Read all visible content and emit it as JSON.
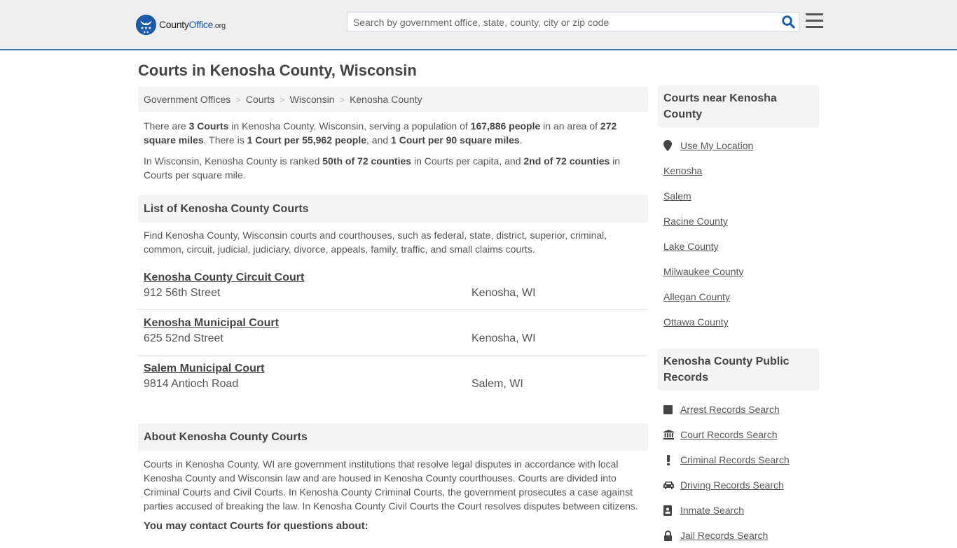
{
  "header": {
    "logo": {
      "part1": "County",
      "part2": "Office",
      "part3": ".org"
    },
    "search": {
      "placeholder": "Search by government office, state, county, city or zip code",
      "value": ""
    },
    "brand_color": "#1a5aa6",
    "accent_border": "#3b7cad"
  },
  "page": {
    "title": "Courts in Kenosha County, Wisconsin"
  },
  "breadcrumb": [
    {
      "label": "Government Offices"
    },
    {
      "label": "Courts"
    },
    {
      "label": "Wisconsin"
    },
    {
      "label": "Kenosha County"
    }
  ],
  "summary": {
    "p1": {
      "t1": "There are ",
      "b1": "3 Courts",
      "t2": " in Kenosha County, Wisconsin, serving a population of ",
      "b2": "167,886 people",
      "t3": " in an area of ",
      "b3": "272 square miles",
      "t4": ". There is ",
      "b4": "1 Court per 55,962 people",
      "t5": ", and ",
      "b5": "1 Court per 90 square miles",
      "t6": "."
    },
    "p2": {
      "t1": "In Wisconsin, Kenosha County is ranked ",
      "b1": "50th of 72 counties",
      "t2": " in Courts per capita, and ",
      "b2": "2nd of 72 counties",
      "t3": " in Courts per square mile."
    }
  },
  "list_section": {
    "heading": "List of Kenosha County Courts",
    "description": "Find Kenosha County, Wisconsin courts and courthouses, such as federal, state, district, superior, criminal, common, circuit, judicial, judiciary, divorce, appeals, family, traffic, and small claims courts.",
    "courts": [
      {
        "name": "Kenosha County Circuit Court",
        "address": "912 56th Street",
        "city": "Kenosha, WI"
      },
      {
        "name": "Kenosha Municipal Court",
        "address": "625 52nd Street",
        "city": "Kenosha, WI"
      },
      {
        "name": "Salem Municipal Court",
        "address": "9814 Antioch Road",
        "city": "Salem, WI"
      }
    ]
  },
  "about_section": {
    "heading": "About Kenosha County Courts",
    "body": "Courts in Kenosha County, WI are government institutions that resolve legal disputes in accordance with local Kenosha County and Wisconsin law and are housed in Kenosha County courthouses. Courts are divided into Criminal Courts and Civil Courts. In Kenosha County Criminal Courts, the government prosecutes a case against parties accused of breaking the law. In Kenosha County Civil Courts the Court resolves disputes between citizens.",
    "contact_heading": "You may contact Courts for questions about:"
  },
  "sidebar": {
    "nearby": {
      "heading": "Courts near Kenosha County",
      "use_location": "Use My Location",
      "links": [
        "Kenosha",
        "Salem",
        "Racine County",
        "Lake County",
        "Milwaukee County",
        "Allegan County",
        "Ottawa County"
      ]
    },
    "records": {
      "heading": "Kenosha County Public Records",
      "links": [
        {
          "label": "Arrest Records Search",
          "icon": "square-icon"
        },
        {
          "label": "Court Records Search",
          "icon": "courthouse-icon"
        },
        {
          "label": "Criminal Records Search",
          "icon": "exclamation-icon"
        },
        {
          "label": "Driving Records Search",
          "icon": "car-icon"
        },
        {
          "label": "Inmate Search",
          "icon": "id-badge-icon"
        },
        {
          "label": "Jail Records Search",
          "icon": "lock-icon"
        }
      ]
    }
  }
}
